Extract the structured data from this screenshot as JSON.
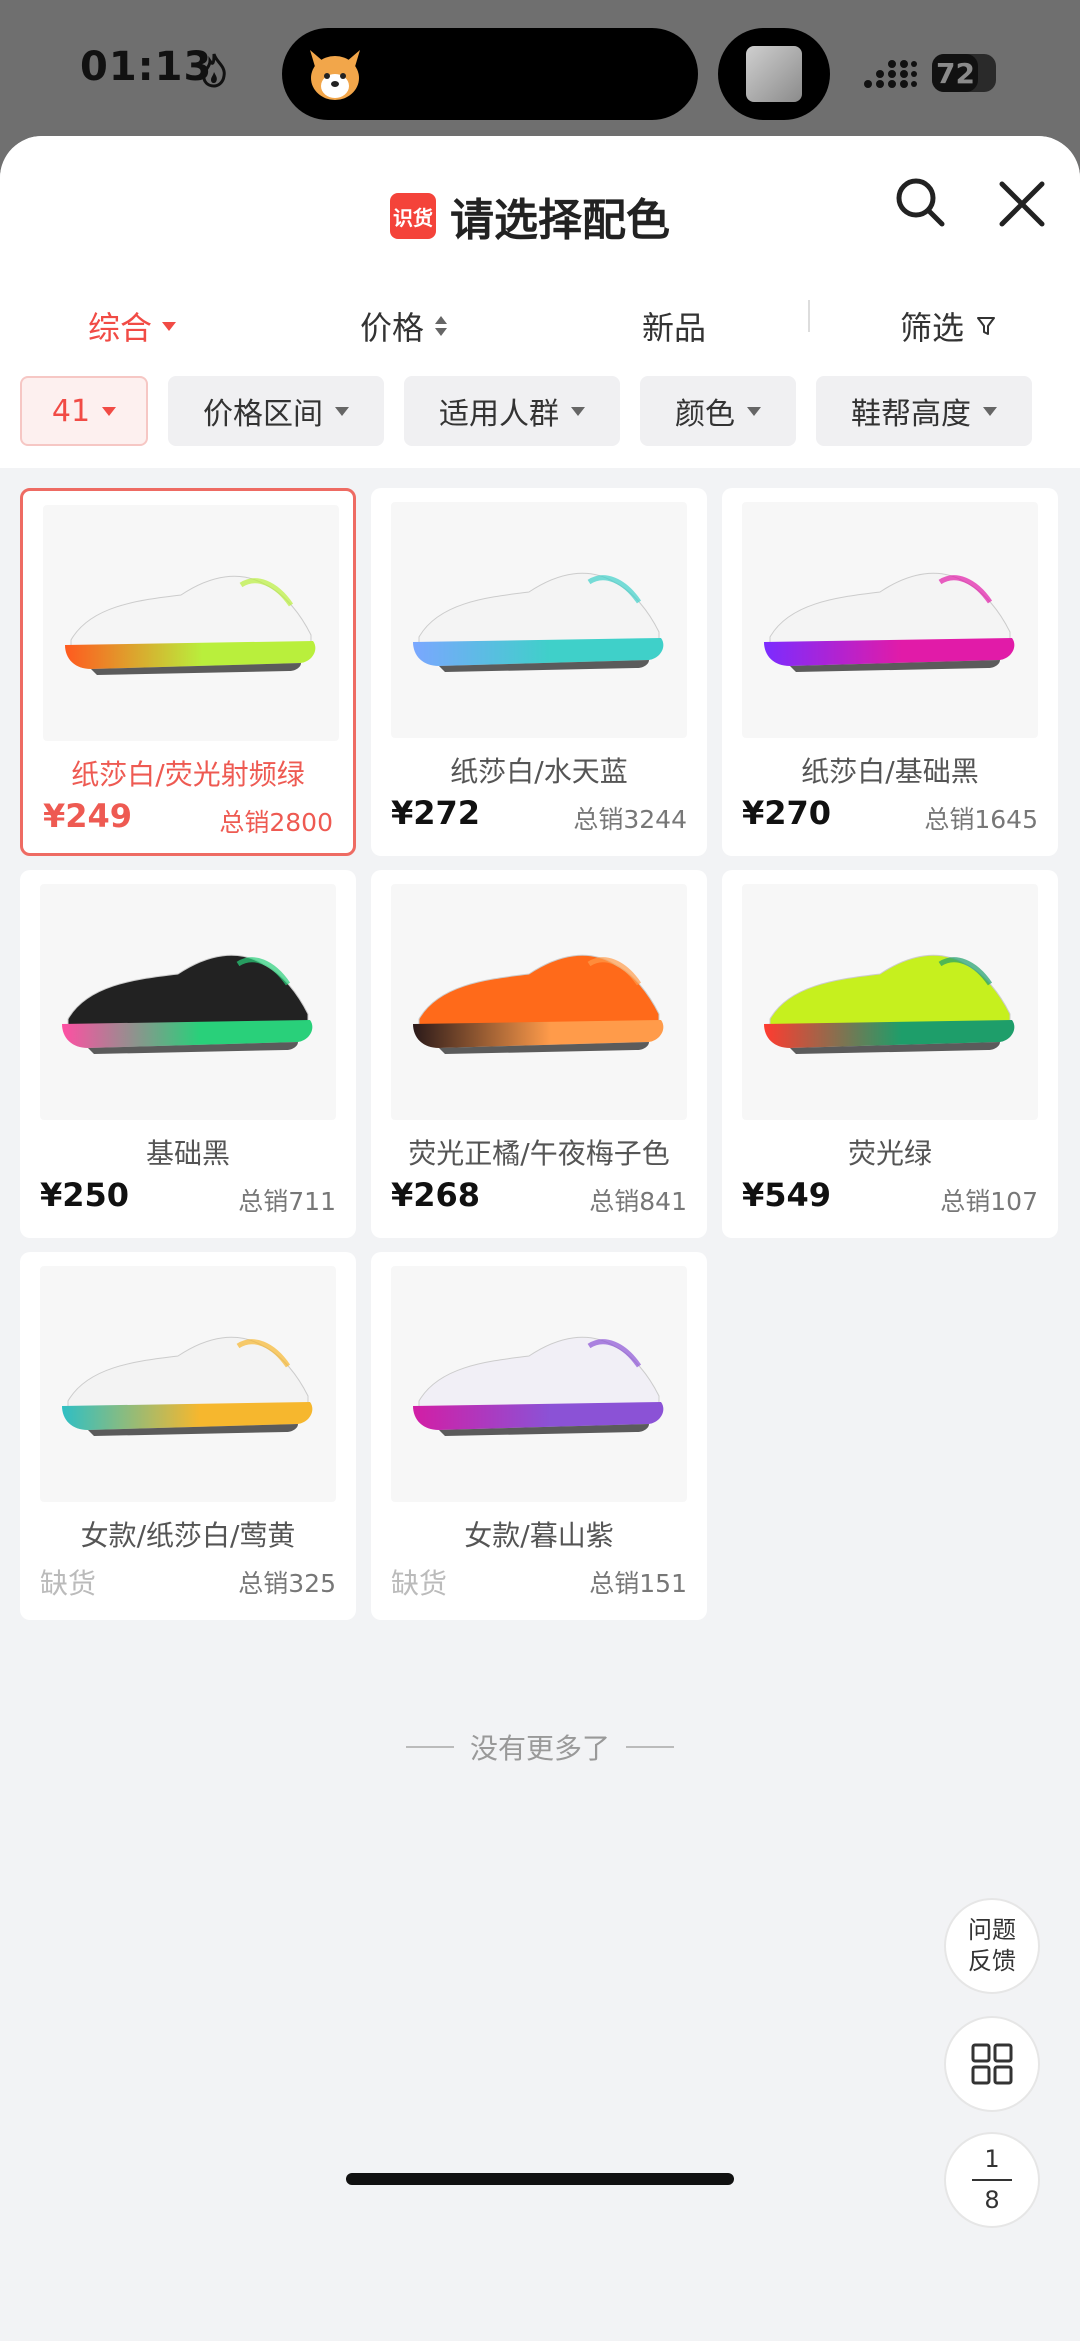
{
  "status_bar": {
    "time": "01:13",
    "battery": "72",
    "battery_level": 0.72
  },
  "header": {
    "brand_logo_text": "识货",
    "title": "请选择配色"
  },
  "sort_tabs": [
    {
      "label": "综合"
    },
    {
      "label": "价格"
    },
    {
      "label": "新品"
    },
    {
      "label": "筛选"
    }
  ],
  "filter_chips": [
    {
      "label": "41"
    },
    {
      "label": "价格区间"
    },
    {
      "label": "适用人群"
    },
    {
      "label": "颜色"
    },
    {
      "label": "鞋帮高度"
    }
  ],
  "products": [
    {
      "name": "纸莎白/荧光射频绿",
      "price": "¥249",
      "sales": "总销2800",
      "colors": [
        "#f5f5f5",
        "#b9ef3c",
        "#ff5a1f"
      ]
    },
    {
      "name": "纸莎白/水天蓝",
      "price": "¥272",
      "sales": "总销3244",
      "colors": [
        "#f4f4f4",
        "#3fd0c9",
        "#7aa7ff"
      ]
    },
    {
      "name": "纸莎白/基础黑",
      "price": "¥270",
      "sales": "总销1645",
      "colors": [
        "#f4f4f4",
        "#e11ba8",
        "#7b2cff"
      ]
    },
    {
      "name": "基础黑",
      "price": "¥250",
      "sales": "总销711",
      "colors": [
        "#222222",
        "#29d07a",
        "#ff4fa3"
      ]
    },
    {
      "name": "荧光正橘/午夜梅子色",
      "price": "¥268",
      "sales": "总销841",
      "colors": [
        "#ff6a1a",
        "#ff9b4a",
        "#2b1a1a"
      ]
    },
    {
      "name": "荧光绿",
      "price": "¥549",
      "sales": "总销107",
      "colors": [
        "#c6f01e",
        "#1e9e6a",
        "#ff3b30"
      ]
    },
    {
      "name": "女款/纸莎白/莺黄",
      "price": "缺货",
      "sales": "总销325",
      "colors": [
        "#f3f3f3",
        "#f6b72e",
        "#2fbfc4"
      ]
    },
    {
      "name": "女款/暮山紫",
      "price": "缺货",
      "sales": "总销151",
      "colors": [
        "#f1eff6",
        "#8b52d6",
        "#d21ea5"
      ]
    }
  ],
  "footer_text": "没有更多了",
  "fabs": {
    "feedback_line1": "问题",
    "feedback_line2": "反馈",
    "page_current": "1",
    "page_total": "8"
  },
  "colors": {
    "accent": "#f14b45",
    "background": "#f2f3f5"
  }
}
